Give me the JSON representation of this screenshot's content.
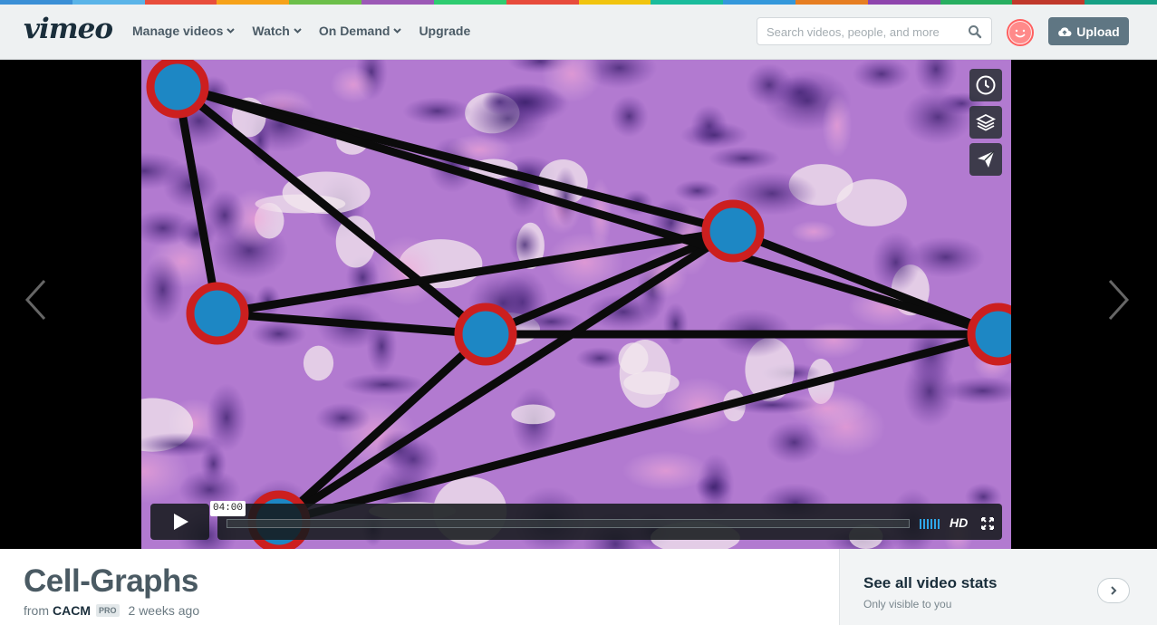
{
  "colors": {
    "rainbow": [
      "#3a8fd6",
      "#5ab4e8",
      "#e84e3c",
      "#f6a21a",
      "#6cbf4a",
      "#9b59b6",
      "#2ecc71",
      "#e74c3c",
      "#f1c40f",
      "#1abc9c",
      "#3498db",
      "#e67e22",
      "#8e44ad",
      "#27ae60",
      "#c0392b",
      "#16a085"
    ],
    "header_bg": "#eef1f2",
    "upload_bg": "#5f7683",
    "node_fill": "#1d87c4",
    "node_ring": "#cc1f1f",
    "edge": "#0b0b0b",
    "volume": "#2fa6e8"
  },
  "header": {
    "logo": "vimeo",
    "nav": [
      {
        "label": "Manage videos",
        "has_dropdown": true
      },
      {
        "label": "Watch",
        "has_dropdown": true
      },
      {
        "label": "On Demand",
        "has_dropdown": true
      },
      {
        "label": "Upgrade",
        "has_dropdown": false
      }
    ],
    "search": {
      "placeholder": "Search videos, people, and more",
      "icon": "search-icon"
    },
    "upload_label": "Upload",
    "upload_icon": "cloud-upload-icon"
  },
  "player": {
    "side_actions": [
      {
        "name": "watch-later-button",
        "icon": "clock-icon"
      },
      {
        "name": "collections-button",
        "icon": "layers-icon"
      },
      {
        "name": "share-button",
        "icon": "paper-plane-icon"
      }
    ],
    "time_tooltip": "04:00",
    "progress": 0.0,
    "hd_label": "HD",
    "prev_icon": "chevron-left-icon",
    "next_icon": "chevron-right-icon"
  },
  "video_info": {
    "title": "Cell-Graphs",
    "from_label": "from",
    "author": "CACM",
    "badge": "PRO",
    "posted": "2 weeks ago"
  },
  "stats": {
    "title": "See all video stats",
    "subtitle": "Only visible to you"
  }
}
